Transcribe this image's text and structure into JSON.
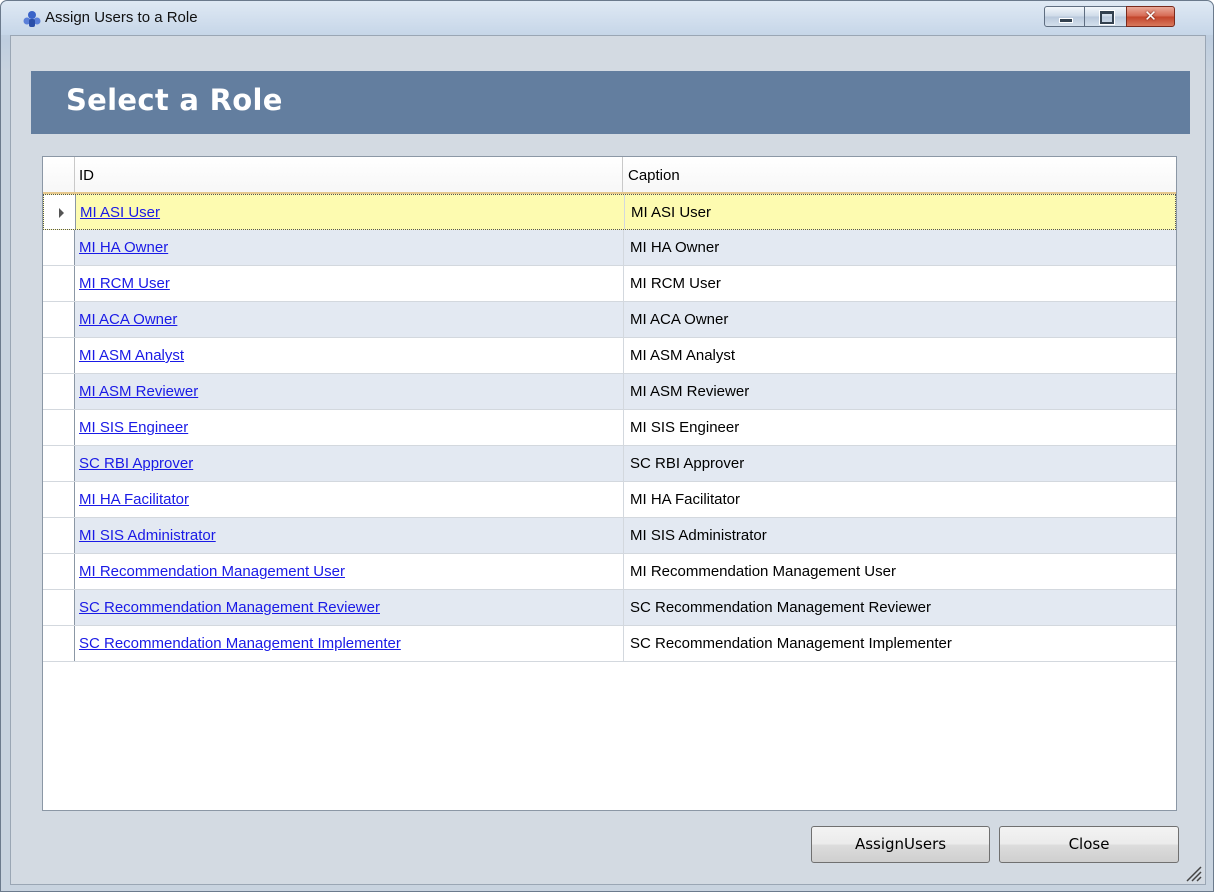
{
  "window": {
    "title": "Assign Users to a Role",
    "icon": "cluster-icon"
  },
  "header": {
    "title": "Select a Role"
  },
  "grid": {
    "columns": [
      "ID",
      "Caption"
    ],
    "selected_index": 0,
    "rows": [
      {
        "id": "MI ASI User",
        "caption": "MI ASI User"
      },
      {
        "id": "MI HA Owner",
        "caption": "MI HA Owner"
      },
      {
        "id": "MI RCM User",
        "caption": "MI RCM User"
      },
      {
        "id": "MI ACA Owner",
        "caption": "MI ACA Owner"
      },
      {
        "id": "MI ASM Analyst",
        "caption": "MI ASM Analyst"
      },
      {
        "id": "MI ASM Reviewer",
        "caption": "MI ASM Reviewer"
      },
      {
        "id": "MI SIS Engineer",
        "caption": "MI SIS Engineer"
      },
      {
        "id": "SC RBI Approver",
        "caption": "SC RBI Approver"
      },
      {
        "id": "MI HA Facilitator",
        "caption": "MI HA Facilitator"
      },
      {
        "id": "MI SIS Administrator",
        "caption": "MI SIS Administrator"
      },
      {
        "id": "MI Recommendation Management User",
        "caption": "MI Recommendation Management User"
      },
      {
        "id": "SC Recommendation Management Reviewer",
        "caption": "SC Recommendation Management Reviewer"
      },
      {
        "id": "SC Recommendation Management Implementer",
        "caption": "SC Recommendation Management Implementer"
      }
    ]
  },
  "buttons": {
    "assign_label": "AssignUsers",
    "close_label": "Close"
  },
  "colors": {
    "header_band": "#637e9f",
    "link": "#1a1ae6",
    "selected_row": "#fdfbb0",
    "alt_row": "#e3e9f2"
  }
}
